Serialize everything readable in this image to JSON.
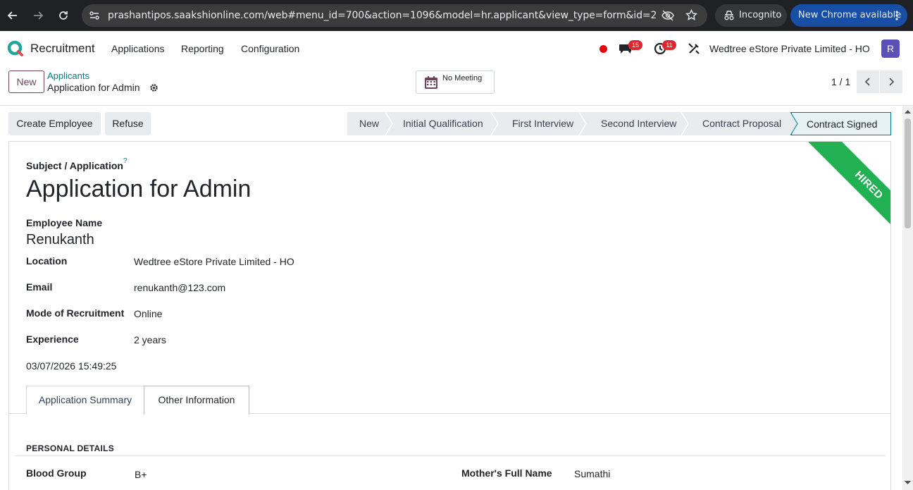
{
  "browser": {
    "url": "prashantipos.saakshionline.com/web#menu_id=700&action=1096&model=hr.applicant&view_type=form&id=2",
    "incognito_label": "Incognito",
    "update_label": "New Chrome available"
  },
  "navbar": {
    "app_name": "Recruitment",
    "menus": [
      "Applications",
      "Reporting",
      "Configuration"
    ],
    "messages_count": "15",
    "activities_count": "11",
    "company": "Wedtree eStore Private Limited - HO",
    "avatar_letter": "R"
  },
  "control_panel": {
    "new_label": "New",
    "breadcrumb_parent": "Applicants",
    "breadcrumb_current": "Application for Admin",
    "meeting_label": "No Meeting",
    "pager": "1 / 1"
  },
  "actions": {
    "create_employee": "Create Employee",
    "refuse": "Refuse"
  },
  "stages": [
    "New",
    "Initial Qualification",
    "First Interview",
    "Second Interview",
    "Contract Proposal",
    "Contract Signed"
  ],
  "active_stage": "Contract Signed",
  "form": {
    "ribbon": "HIRED",
    "subject_label": "Subject / Application",
    "help_mark": "?",
    "title": "Application for Admin",
    "employee_name_label": "Employee Name",
    "employee_name": "Renukanth",
    "location_label": "Location",
    "location": "Wedtree eStore Private Limited - HO",
    "email_label": "Email",
    "email": "renukanth@123.com",
    "mode_label": "Mode of Recruitment",
    "mode": "Online",
    "experience_label": "Experience",
    "experience": "2 years",
    "datetime": "03/07/2026 15:49:25"
  },
  "tabs": [
    "Application Summary",
    "Other Information"
  ],
  "active_tab": "Other Information",
  "personal_details": {
    "heading": "PERSONAL DETAILS",
    "blood_group_label": "Blood Group",
    "blood_group": "B+",
    "mother_label": "Mother's Full Name",
    "mother": "Sumathi"
  },
  "colors": {
    "brand": "#71435b",
    "link": "#017e84",
    "ribbon": "#21b152",
    "badge": "#e0262c"
  }
}
